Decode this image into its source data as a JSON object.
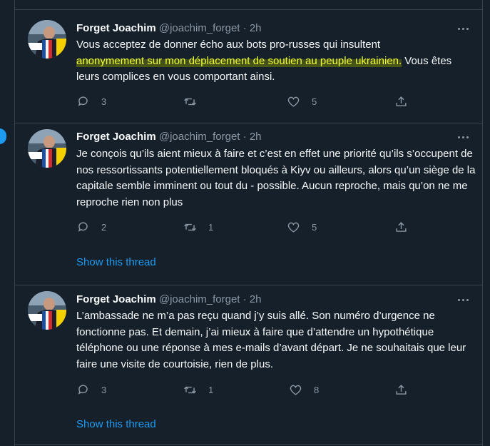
{
  "colors": {
    "background": "#15202b",
    "text": "#f7f9f9",
    "secondary": "#8b98a5",
    "accent": "#1d9bf0",
    "border": "#38444d",
    "highlight": "#f2ff33"
  },
  "tweets": [
    {
      "name": "Forget Joachim",
      "handle": "@joachim_forget",
      "sep": "·",
      "time": "2h",
      "text_before": "Vous acceptez de donner écho aux bots pro-russes qui insultent",
      "text_highlight": "anonymement sur mon déplacement de soutien au peuple ukrainien.",
      "text_after": " Vous êtes leurs complices en vous comportant ainsi.",
      "replies": "3",
      "retweets": "",
      "likes": "5",
      "show_thread": ""
    },
    {
      "name": "Forget Joachim",
      "handle": "@joachim_forget",
      "sep": "·",
      "time": "2h",
      "text": "Je conçois qu’ils aient mieux à faire et c’est en effet une priorité qu’ils s’occupent de nos ressortissants potentiellement bloqués à Kiyv ou ailleurs, alors qu’un siège de la capitale semble imminent ou tout du - possible. Aucun reproche, mais qu’on ne me reproche rien non plus",
      "replies": "2",
      "retweets": "1",
      "likes": "5",
      "show_thread": "Show this thread"
    },
    {
      "name": "Forget Joachim",
      "handle": "@joachim_forget",
      "sep": "·",
      "time": "2h",
      "text": "L’ambassade ne m’a pas reçu quand j’y suis allé. Son numéro d’urgence ne fonctionne pas. Et demain, j’ai mieux à faire que d’attendre un hypothétique téléphone ou une réponse à mes e-mails d’avant départ. Je ne souhaitais que leur faire une visite de courtoisie, rien de plus.",
      "replies": "3",
      "retweets": "1",
      "likes": "8",
      "show_thread": "Show this thread"
    }
  ],
  "icons": {
    "reply": "reply-icon",
    "retweet": "retweet-icon",
    "like": "heart-icon",
    "share": "share-icon",
    "more": "more-icon"
  }
}
